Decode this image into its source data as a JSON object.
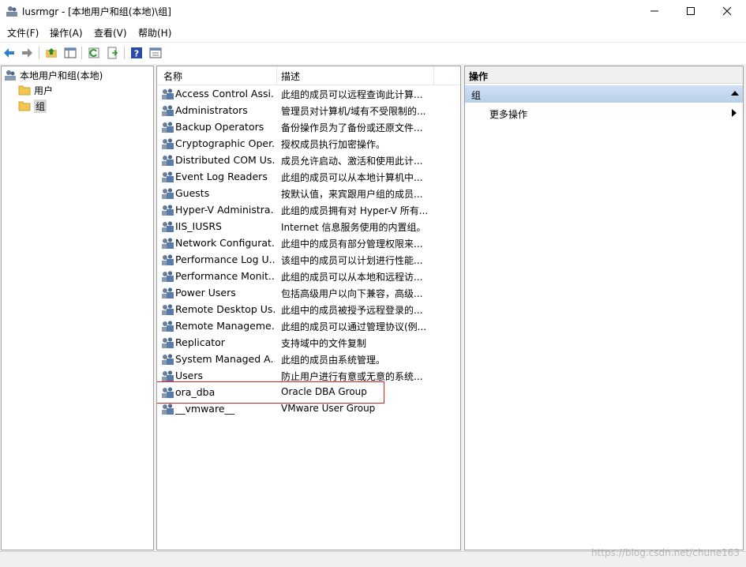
{
  "window": {
    "title": "lusrmgr - [本地用户和组(本地)\\组]",
    "controls": [
      "minimize",
      "maximize",
      "close"
    ]
  },
  "menu": [
    {
      "label": "文件(F)"
    },
    {
      "label": "操作(A)"
    },
    {
      "label": "查看(V)"
    },
    {
      "label": "帮助(H)"
    }
  ],
  "toolbar": {
    "icons": [
      "back-icon",
      "forward-icon",
      "up-folder-icon",
      "show-hide-tree-icon",
      "refresh-icon",
      "export-list-icon",
      "help-icon",
      "properties-icon"
    ]
  },
  "tree": {
    "root": "本地用户和组(本地)",
    "children": [
      {
        "label": "用户",
        "selected": false
      },
      {
        "label": "组",
        "selected": true
      }
    ]
  },
  "list": {
    "columns": [
      "名称",
      "描述"
    ],
    "rows": [
      {
        "name": "Access Control Assi...",
        "desc": "此组的成员可以远程查询此计算..."
      },
      {
        "name": "Administrators",
        "desc": "管理员对计算机/域有不受限制的..."
      },
      {
        "name": "Backup Operators",
        "desc": "备份操作员为了备份或还原文件..."
      },
      {
        "name": "Cryptographic Oper...",
        "desc": "授权成员执行加密操作。"
      },
      {
        "name": "Distributed COM Us...",
        "desc": "成员允许启动、激活和使用此计..."
      },
      {
        "name": "Event Log Readers",
        "desc": "此组的成员可以从本地计算机中..."
      },
      {
        "name": "Guests",
        "desc": "按默认值，来宾跟用户组的成员..."
      },
      {
        "name": "Hyper-V Administra...",
        "desc": "此组的成员拥有对 Hyper-V 所有..."
      },
      {
        "name": "IIS_IUSRS",
        "desc": "Internet 信息服务使用的内置组。"
      },
      {
        "name": "Network Configurat...",
        "desc": "此组中的成员有部分管理权限来..."
      },
      {
        "name": "Performance Log U...",
        "desc": "该组中的成员可以计划进行性能..."
      },
      {
        "name": "Performance Monit...",
        "desc": "此组的成员可以从本地和远程访..."
      },
      {
        "name": "Power Users",
        "desc": "包括高级用户以向下兼容，高级..."
      },
      {
        "name": "Remote Desktop Us...",
        "desc": "此组中的成员被授予远程登录的..."
      },
      {
        "name": "Remote Manageme...",
        "desc": "此组的成员可以通过管理协议(例..."
      },
      {
        "name": "Replicator",
        "desc": "支持域中的文件复制"
      },
      {
        "name": "System Managed A...",
        "desc": "此组的成员由系统管理。"
      },
      {
        "name": "Users",
        "desc": "防止用户进行有意或无意的系统..."
      },
      {
        "name": "ora_dba",
        "desc": "Oracle DBA Group",
        "highlighted": true
      },
      {
        "name": "__vmware__",
        "desc": "VMware User Group"
      }
    ]
  },
  "actions": {
    "header": "操作",
    "group": "组",
    "items": [
      {
        "label": "更多操作"
      }
    ]
  },
  "watermark": "https://blog.csdn.net/chune163",
  "colors": {
    "highlight_border": "#e02020",
    "group_header": "#c4d7ee"
  }
}
